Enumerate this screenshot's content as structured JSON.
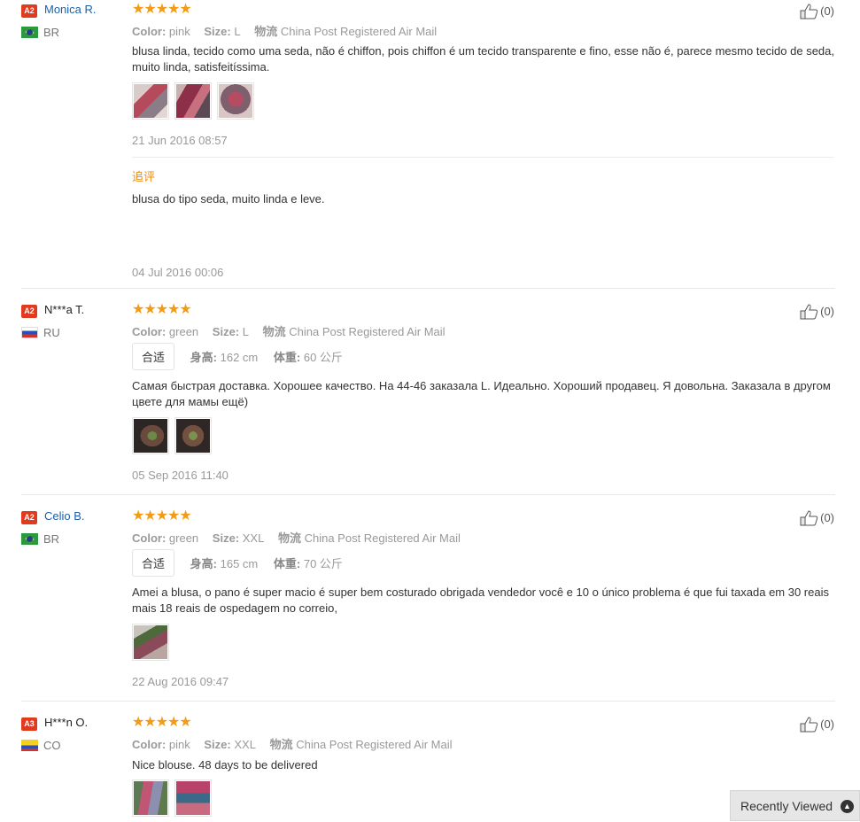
{
  "reviews": [
    {
      "badge": "A2",
      "name": "Monica R.",
      "country": "BR",
      "stars": "★★★★★",
      "color_label": "Color:",
      "color": "pink",
      "size_label": "Size:",
      "size": "L",
      "shipping_label": "物流",
      "shipping": "China Post Registered Air Mail",
      "text": "blusa linda, tecido como uma seda, não é chiffon, pois chiffon é um tecido transparente e fino, esse não é, parece mesmo tecido de seda, muito linda, satisfeitíssima.",
      "date": "21 Jun 2016 08:57",
      "followup_label": "追评",
      "followup_text": "blusa do tipo seda, muito linda e leve.",
      "followup_date": "04 Jul 2016 00:06",
      "likes": "(0)"
    },
    {
      "badge": "A2",
      "name": "N***a T.",
      "country": "RU",
      "stars": "★★★★★",
      "color_label": "Color:",
      "color": "green",
      "size_label": "Size:",
      "size": "L",
      "shipping_label": "物流",
      "shipping": "China Post Registered Air Mail",
      "fit": "合适",
      "height_label": "身高:",
      "height": "162 cm",
      "weight_label": "体重:",
      "weight": "60 公斤",
      "text": "Самая быстрая доставка. Хорошее качество. На 44-46 заказала L. Идеально. Хороший продавец. Я довольна. Заказала в другом цвете для мамы ещё)",
      "date": "05 Sep 2016 11:40",
      "likes": "(0)"
    },
    {
      "badge": "A2",
      "name": "Celio B.",
      "country": "BR",
      "stars": "★★★★★",
      "color_label": "Color:",
      "color": "green",
      "size_label": "Size:",
      "size": "XXL",
      "shipping_label": "物流",
      "shipping": "China Post Registered Air Mail",
      "fit": "合适",
      "height_label": "身高:",
      "height": "165 cm",
      "weight_label": "体重:",
      "weight": "70 公斤",
      "text": "Amei a blusa, o pano é super macio é super bem costurado obrigada vendedor você e 10 o único problema é que fui taxada em 30 reais mais 18 reais de ospedagem no correio,",
      "date": "22 Aug 2016 09:47",
      "likes": "(0)"
    },
    {
      "badge": "A3",
      "name": "H***n O.",
      "country": "CO",
      "stars": "★★★★★",
      "color_label": "Color:",
      "color": "pink",
      "size_label": "Size:",
      "size": "XXL",
      "shipping_label": "物流",
      "shipping": "China Post Registered Air Mail",
      "text": "Nice blouse. 48 days to be delivered",
      "likes": "(0)"
    }
  ],
  "recently_viewed": "Recently Viewed",
  "colors": {
    "star": "#f39b15",
    "link": "#1a5faa",
    "badge": "#e13a1f",
    "followup": "#e98b1a"
  }
}
